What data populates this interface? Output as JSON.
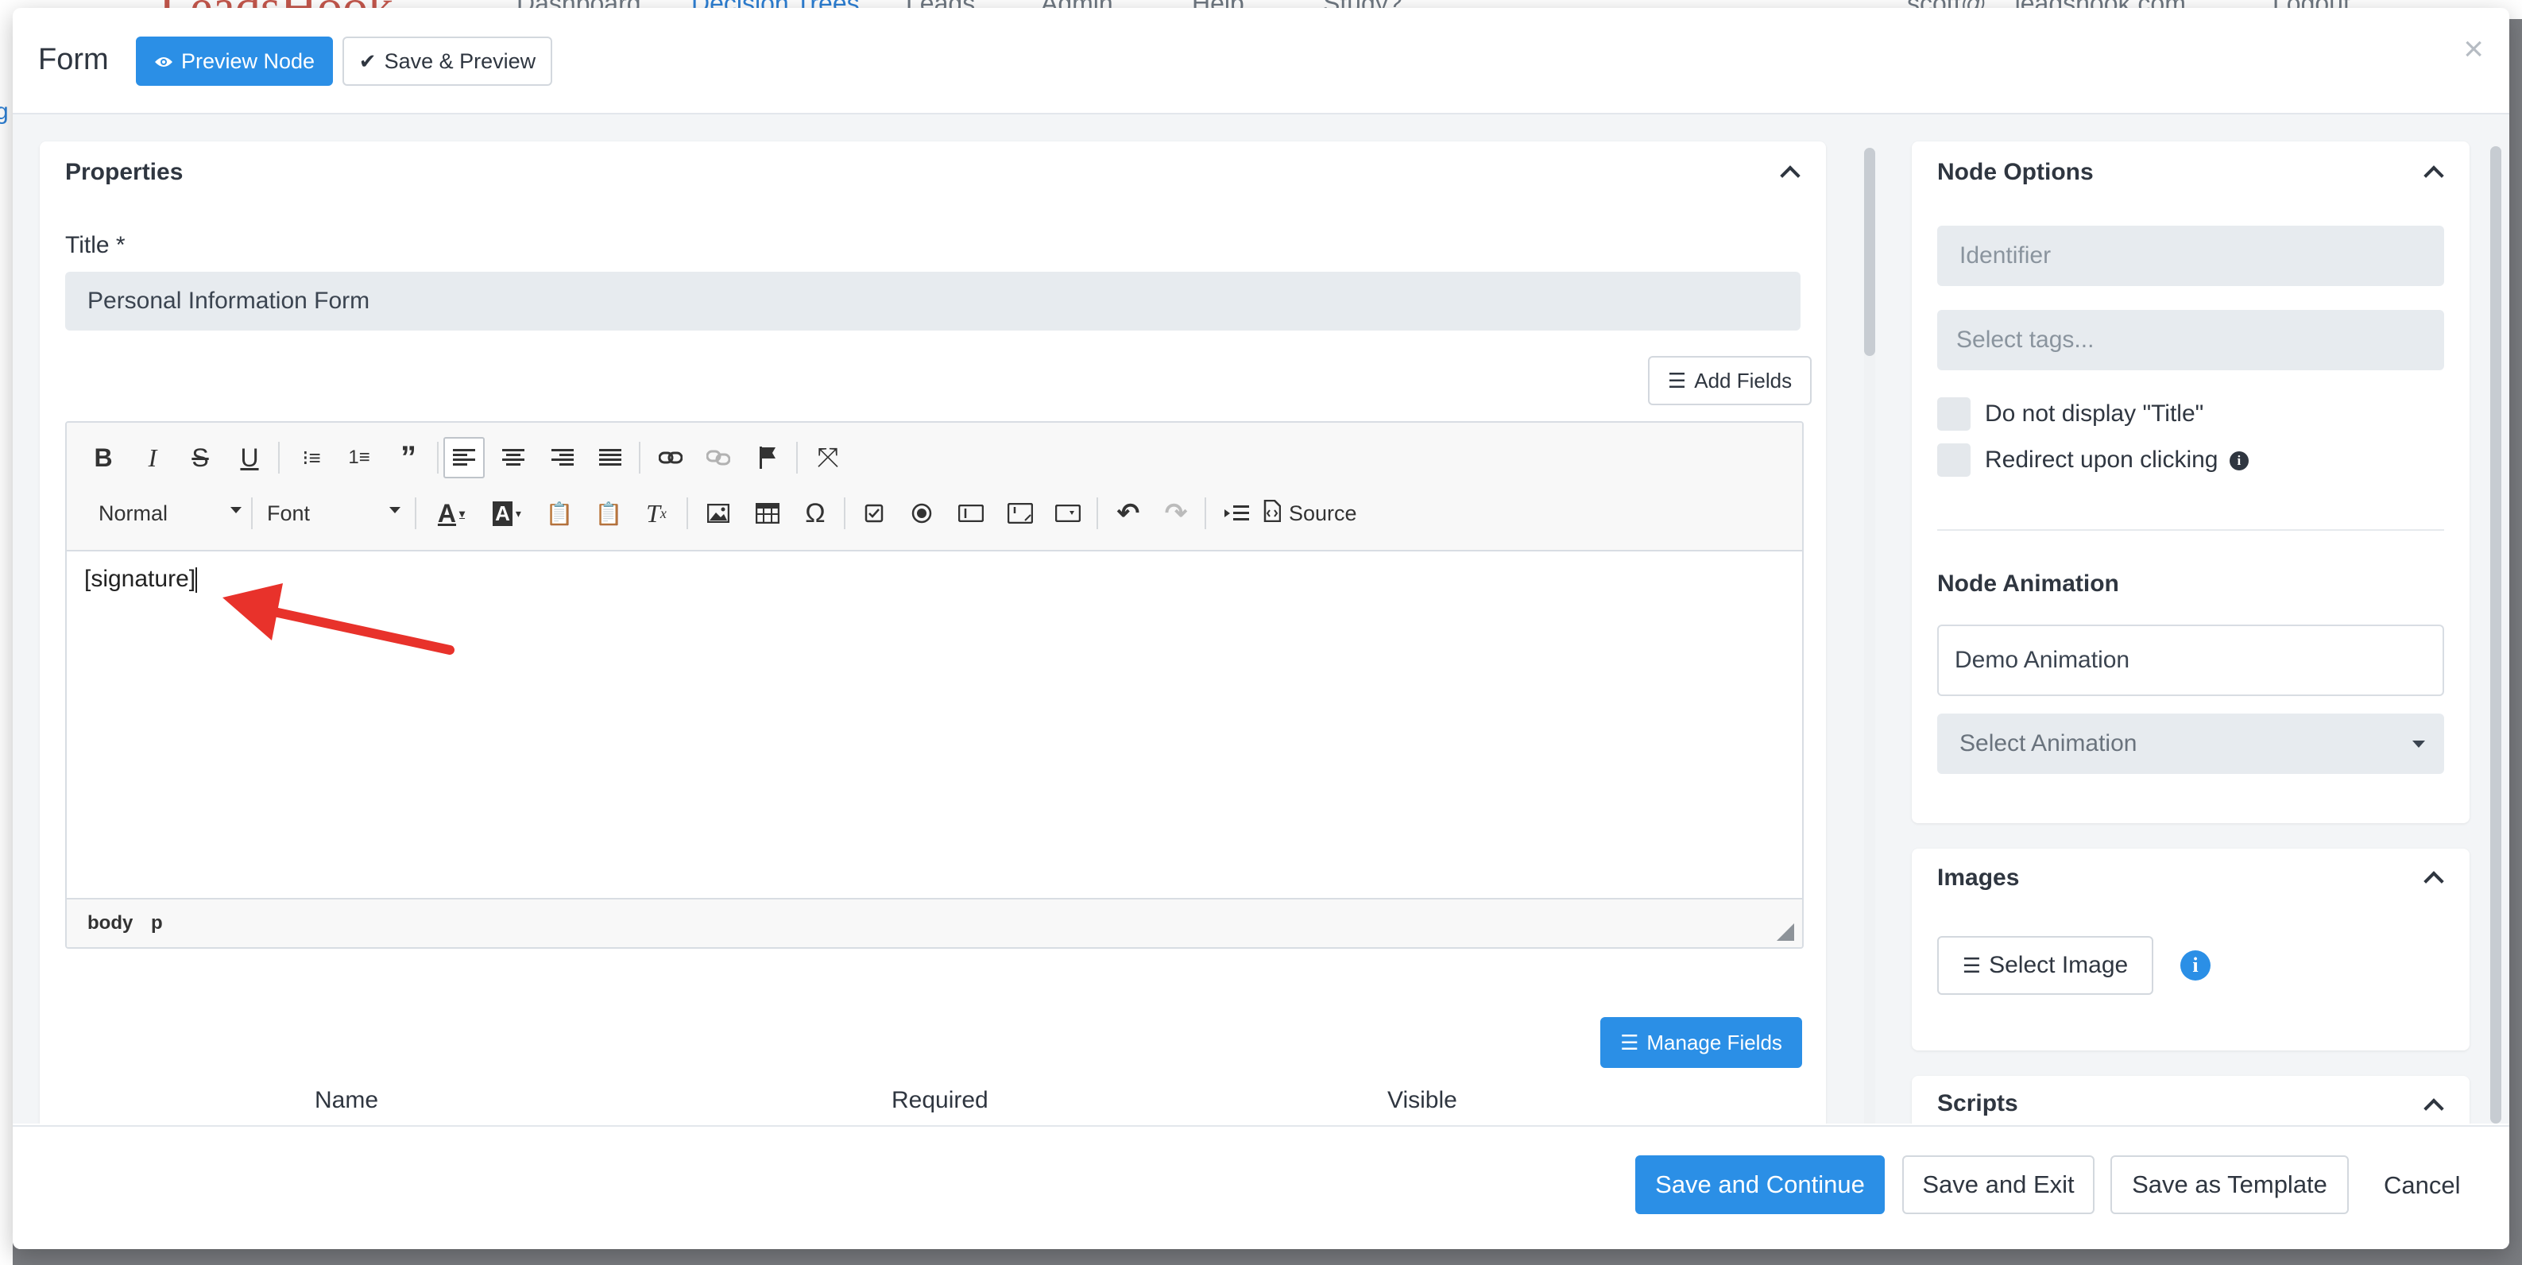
{
  "background": {
    "logo": "LeadsHook",
    "nav": [
      "Dashboard",
      "Decision Trees",
      "Leads",
      "Admin",
      "Help",
      "Study?"
    ],
    "user": "scott@... leadshook.com",
    "logout": "Logout"
  },
  "modal": {
    "title": "Form",
    "preview_node_label": "Preview Node",
    "save_preview_label": "Save & Preview",
    "close_symbol": "×"
  },
  "properties": {
    "heading": "Properties",
    "title_label": "Title *",
    "title_value": "Personal Information Form",
    "add_fields_label": "Add Fields",
    "manage_fields_label": "Manage Fields",
    "columns": [
      "Name",
      "Required",
      "Visible"
    ]
  },
  "editor": {
    "format_value": "Normal",
    "font_value": "Font",
    "source_label": "Source",
    "content": "[signature]",
    "statusbar": [
      "body",
      "p"
    ],
    "toolbar_row1": [
      "bold-icon",
      "italic-icon",
      "strikethrough-icon",
      "underline-icon",
      "bulleted-list-icon",
      "numbered-list-icon",
      "blockquote-icon",
      "align-left-icon",
      "align-center-icon",
      "align-right-icon",
      "justify-icon",
      "link-icon",
      "unlink-icon",
      "anchor-flag-icon",
      "maximize-icon"
    ],
    "toolbar_row2": [
      "text-color-icon",
      "background-color-icon",
      "paste-text-icon",
      "paste-word-icon",
      "remove-format-icon",
      "image-icon",
      "table-icon",
      "special-char-icon",
      "checkbox-icon",
      "radio-icon",
      "text-field-icon",
      "textarea-icon",
      "select-icon",
      "undo-icon",
      "redo-icon",
      "indent-icon",
      "source-icon"
    ]
  },
  "node_options": {
    "heading": "Node Options",
    "identifier_placeholder": "Identifier",
    "tags_placeholder": "Select tags...",
    "no_title_label": "Do not display \"Title\"",
    "redirect_label": "Redirect upon clicking",
    "animation_heading": "Node Animation",
    "animation_value": "Demo Animation",
    "select_animation": "Select Animation"
  },
  "images": {
    "heading": "Images",
    "select_image_label": "Select Image"
  },
  "scripts": {
    "heading": "Scripts"
  },
  "footer": {
    "save_continue": "Save and Continue",
    "save_exit": "Save and Exit",
    "save_template": "Save as Template",
    "cancel": "Cancel"
  },
  "colors": {
    "primary": "#2b8fe6",
    "annotation_arrow": "#e8322b"
  }
}
